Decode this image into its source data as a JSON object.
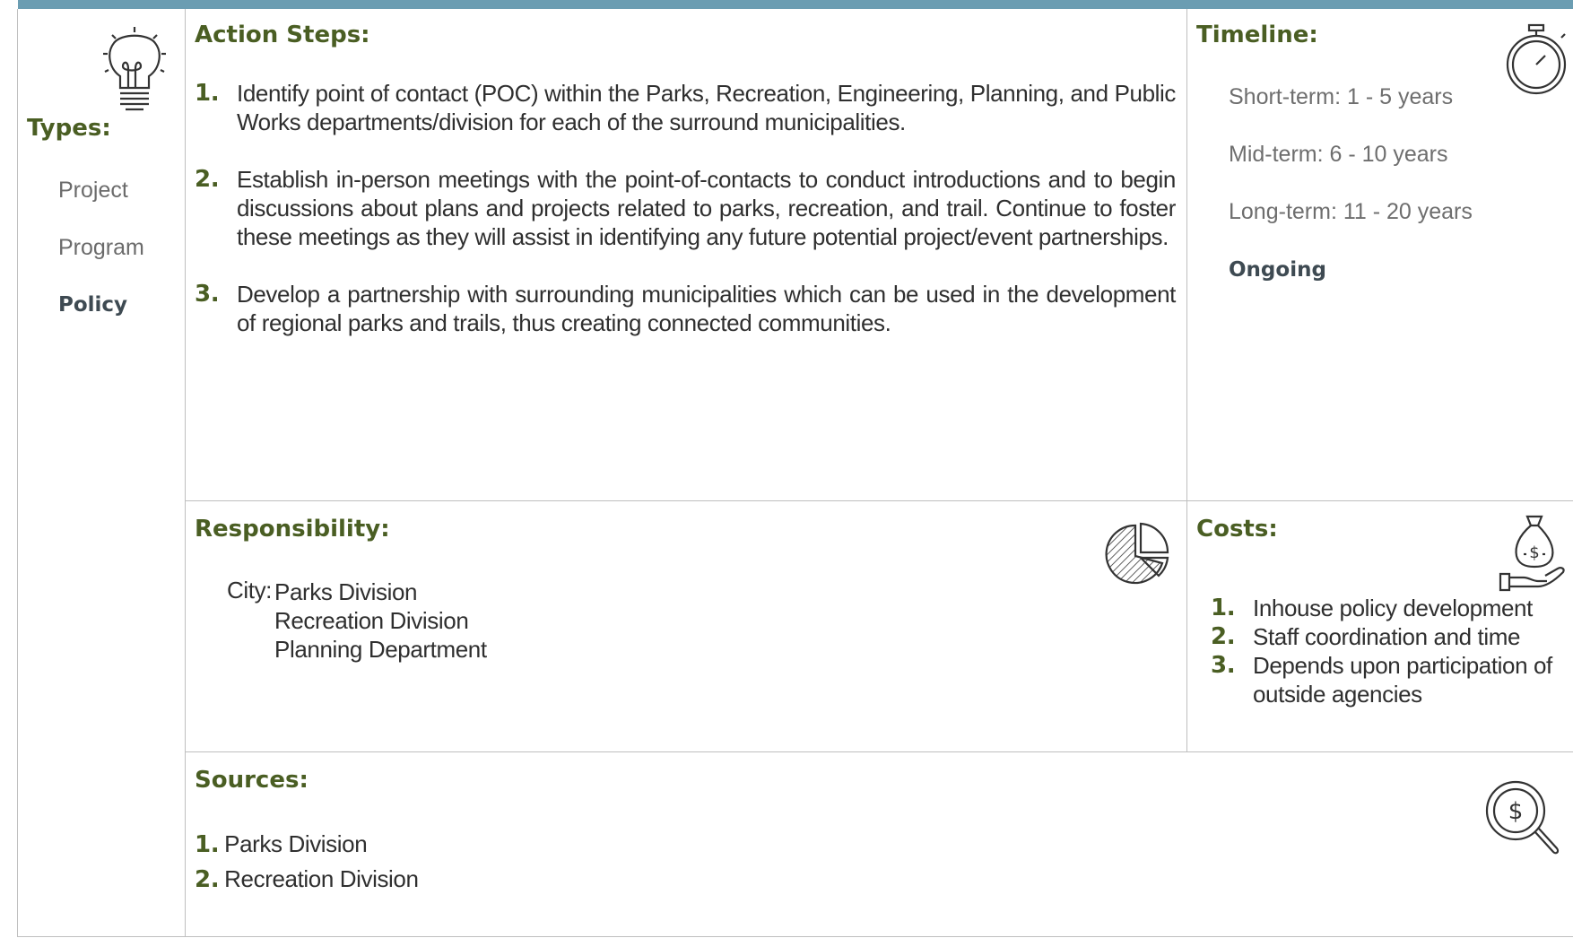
{
  "types": {
    "heading": "Types:",
    "items": [
      {
        "label": "Project",
        "active": false
      },
      {
        "label": "Program",
        "active": false
      },
      {
        "label": "Policy",
        "active": true
      }
    ]
  },
  "action_steps": {
    "heading": "Action Steps:",
    "items": [
      {
        "num": "1.",
        "text": "Identify point of contact (POC) within the Parks, Recreation, Engineering, Planning, and Public Works departments/division for each of the surround municipalities."
      },
      {
        "num": "2.",
        "text": "Establish in-person meetings with the point-of-contacts to conduct introductions and to begin discussions about plans and projects related to parks, recreation, and trail. Continue to foster these meetings as they will assist in identifying any future potential project/event partnerships."
      },
      {
        "num": "3.",
        "text": "Develop a partnership with surrounding municipalities which can be used in the development of regional parks and trails, thus creating connected communities."
      }
    ]
  },
  "timeline": {
    "heading": "Timeline:",
    "items": [
      {
        "label": "Short-term:  1 - 5 years",
        "active": false
      },
      {
        "label": "Mid-term:  6 - 10 years",
        "active": false
      },
      {
        "label": "Long-term:  11 - 20 years",
        "active": false
      },
      {
        "label": "Ongoing",
        "active": true
      }
    ]
  },
  "responsibility": {
    "heading": "Responsibility:",
    "entity_label": "City:",
    "entries": [
      "Parks Division",
      "Recreation Division",
      "Planning Department"
    ]
  },
  "costs": {
    "heading": "Costs:",
    "items": [
      {
        "num": "1.",
        "text": "Inhouse policy development"
      },
      {
        "num": "2.",
        "text": "Staff coordination and time"
      },
      {
        "num": "3.",
        "text": "Depends upon participation of outside agencies"
      }
    ]
  },
  "sources": {
    "heading": "Sources:",
    "items": [
      {
        "num": "1.",
        "text": "Parks Division"
      },
      {
        "num": "2.",
        "text": "Recreation Division"
      }
    ]
  },
  "colors": {
    "heading_green": "#4a5e23",
    "top_bar_blue": "#6b9db2",
    "grid_gray": "#bfbfbf",
    "active_slate": "#3e4a52"
  },
  "icons": [
    "lightbulb-icon",
    "stopwatch-icon",
    "pie-chart-icon",
    "money-bag-hand-icon",
    "dollar-search-icon"
  ]
}
